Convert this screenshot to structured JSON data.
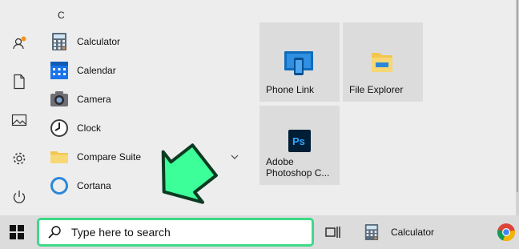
{
  "start_menu": {
    "group_letter": "C",
    "apps": [
      {
        "label": "Calculator",
        "icon": "calculator-icon"
      },
      {
        "label": "Calendar",
        "icon": "calendar-icon"
      },
      {
        "label": "Camera",
        "icon": "camera-icon"
      },
      {
        "label": "Clock",
        "icon": "clock-icon"
      },
      {
        "label": "Compare Suite",
        "icon": "folder-icon",
        "expandable": true
      },
      {
        "label": "Cortana",
        "icon": "cortana-icon"
      }
    ],
    "tiles": [
      {
        "label": "Phone Link",
        "icon": "phone-link-icon"
      },
      {
        "label": "File Explorer",
        "icon": "file-explorer-icon"
      },
      {
        "label": "Adobe Photoshop C...",
        "icon": "photoshop-icon",
        "icon_text": "Ps"
      }
    ],
    "rail": [
      "user-icon",
      "document-icon",
      "pictures-icon",
      "settings-icon",
      "power-icon"
    ]
  },
  "taskbar": {
    "search_placeholder": "Type here to search",
    "pinned_app_label": "Calculator"
  },
  "colors": {
    "highlight": "#3fd98a",
    "arrow_fill": "#3dff9a",
    "photoshop_bg": "#001e36",
    "photoshop_text": "#31a8ff",
    "presence_dot": "#f7941d"
  }
}
